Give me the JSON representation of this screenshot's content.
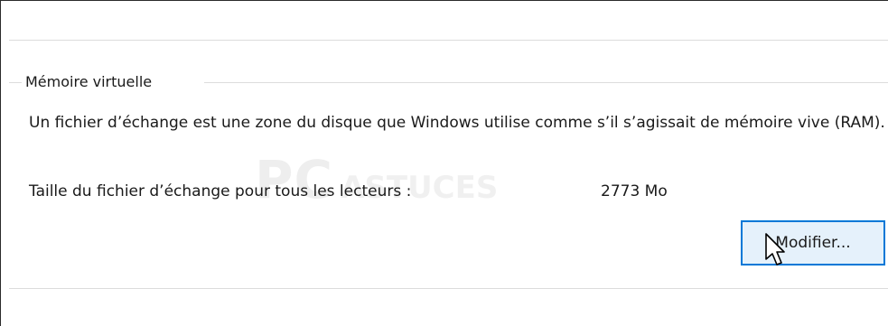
{
  "virtual_memory": {
    "title": "Mémoire virtuelle",
    "description": "Un fichier d’échange est une zone du disque que Windows utilise comme s’il s’agissait de mémoire vive (RAM).",
    "paging_size_label": "Taille du fichier d’échange pour tous les lecteurs :",
    "paging_size_value": "2773 Mo",
    "modify_button_label": "Modifier..."
  },
  "watermark": {
    "main_text": "PC",
    "sub_text": "ASTUCES"
  },
  "colors": {
    "button_border": "#0078d7",
    "button_background": "#e5f1fb",
    "separator": "#dcdcdc"
  },
  "icons": {
    "cursor": "arrow-cursor-icon"
  }
}
